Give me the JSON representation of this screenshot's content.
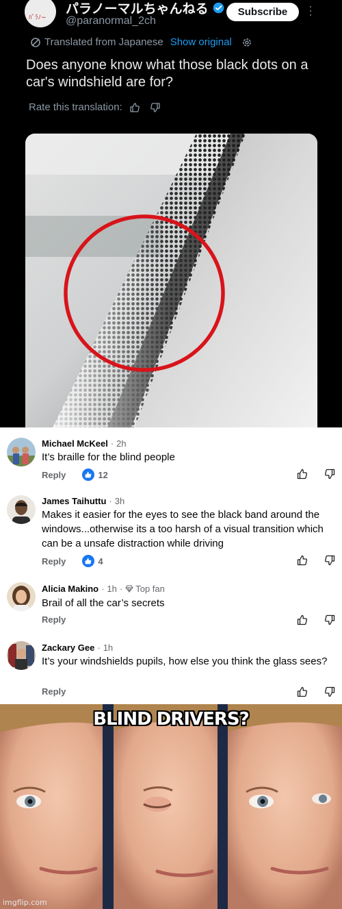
{
  "tweet": {
    "display_name": "パラノーマルちゃんねる",
    "handle": "@paranormal_2ch",
    "subscribe_label": "Subscribe",
    "translated_label": "Translated from Japanese",
    "show_original_label": "Show original",
    "text": "Does anyone know what those black dots on a car's windshield are for?",
    "rate_label": "Rate this translation:"
  },
  "comments": [
    {
      "name": "Michael McKeel",
      "time": "2h",
      "text": "It’s braille for the blind people",
      "reply_label": "Reply",
      "likes": "12"
    },
    {
      "name": "James Taihuttu",
      "time": "3h",
      "text": "Makes it easier for the eyes to see the black band around the windows...otherwise its a too harsh of a  visual transition which can be a unsafe distraction while driving",
      "reply_label": "Reply",
      "likes": "4"
    },
    {
      "name": "Alicia Makino",
      "time": "1h",
      "badge": "Top fan",
      "text": "Brail of all the car’s secrets",
      "reply_label": "Reply"
    },
    {
      "name": "Zackary Gee",
      "time": "1h",
      "text": "It’s your windshields pupils, how else you think the glass sees?",
      "reply_label": "Reply"
    }
  ],
  "meme": {
    "caption": "BLIND DRIVERS?",
    "watermark": "imgflip.com"
  },
  "colors": {
    "twitter_bg": "#000000",
    "link_blue": "#1d9bf0",
    "facebook_blue": "#1877f2",
    "annotation_red": "#d8141a"
  }
}
